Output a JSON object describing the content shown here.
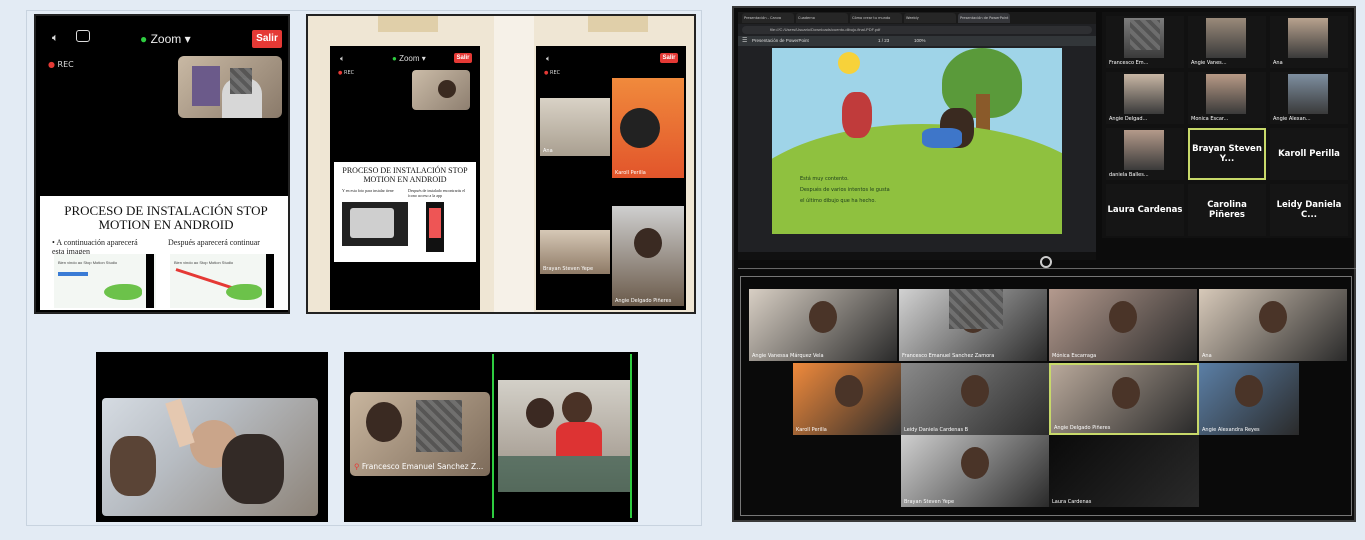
{
  "zoom_top_left": {
    "meeting_menu": "Zoom",
    "leave_label": "Salir",
    "rec_label": "REC",
    "slide": {
      "title": "PROCESO DE INSTALACIÓN STOP MOTION EN ANDROID",
      "bullet_left": "A continuación aparecerá esta imagen",
      "bullet_right": "Después aparecerá continuar",
      "screen_caption_left": "Bien vindo ao Stop Motion Studio",
      "screen_caption_right": "Bien vindo ao Stop Motion Studio"
    }
  },
  "zoom_mid": {
    "meeting_menu": "Zoom",
    "leave_label": "Salir",
    "rec_label": "REC",
    "slide_title": "PROCESO DE INSTALACIÓN STOP MOTION EN ANDROID",
    "bullet_left": "Y en esta foto para instalar tiene",
    "bullet_right": "Después de instalado encontrarás el ícono acceso a la app"
  },
  "zoom_right_phone": {
    "leave_label": "Salir",
    "rec_label": "REC",
    "participants": [
      {
        "name": "Ana"
      },
      {
        "name": "Karoll Perilla"
      },
      {
        "name": "Brayan Steven Yepe"
      },
      {
        "name": "Angie Delgado Piñeres"
      }
    ]
  },
  "bottom_mid_right": {
    "participant_name": "Francesco Emanuel Sanchez Z..."
  },
  "browser": {
    "tabs": [
      "Presentación - Canva",
      "Cuaderno",
      "Cómo crear tu mundo",
      "Weebly",
      "Presentación de PowerPoint"
    ],
    "url": "file:///C:/Users/Usuario/Downloads/cuento-dibujo-final-PDF.pdf",
    "doc_title": "Presentación de PowerPoint",
    "page_indicator": "1 / 23",
    "zoom_level": "100%",
    "story_lines": [
      "Está muy contento.",
      "Después de varios intentos le gusta",
      "el último dibujo que ha hecho."
    ]
  },
  "gallery_top": {
    "tiles": [
      {
        "name": "Francesco Em..."
      },
      {
        "name": "Angie Vanes..."
      },
      {
        "name": "Ana"
      },
      {
        "name": "Angie Delgad..."
      },
      {
        "name": "Monica Escar..."
      },
      {
        "name": "Angie Alexan..."
      },
      {
        "name": "daniela Balles..."
      },
      {
        "name": "Brayan Steven Y..."
      },
      {
        "name": "Karoll Perilla"
      },
      {
        "name": "Laura Cardenas"
      },
      {
        "name": "Carolina Piñeres"
      },
      {
        "name": "Leidy Daniela C..."
      }
    ]
  },
  "gallery_bottom": {
    "tiles": [
      {
        "name": "Angie Vanessa Márquez Vela"
      },
      {
        "name": "Francesco Emanuel Sanchez Zamora"
      },
      {
        "name": "Mónica Escarraga"
      },
      {
        "name": "Ana"
      },
      {
        "name": "Karoll Perilla"
      },
      {
        "name": "Leidy Daniela Cardenas B"
      },
      {
        "name": "Angie Delgado Piñeres"
      },
      {
        "name": "Angie Alexandra Reyes"
      },
      {
        "name": "Brayan Steven Yepe"
      },
      {
        "name": "Laura Cardenas"
      }
    ]
  },
  "colors": {
    "zoom_green": "#2ecc40",
    "leave_red": "#e53935",
    "active_speaker": "#c8d96a",
    "background": "#e3ebf4"
  }
}
